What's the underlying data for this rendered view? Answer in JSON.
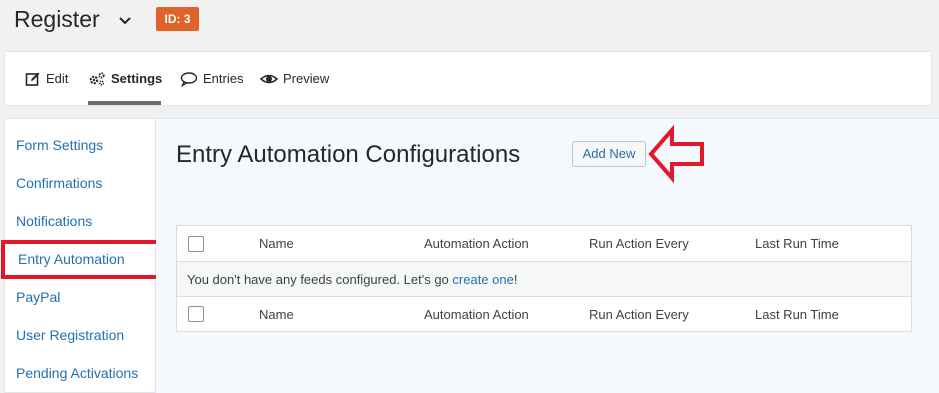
{
  "header": {
    "title": "Register",
    "id_badge": "ID: 3"
  },
  "toolbar": {
    "edit_label": "Edit",
    "settings_label": "Settings",
    "entries_label": "Entries",
    "preview_label": "Preview",
    "active": "Settings"
  },
  "sidebar": {
    "items": [
      {
        "label": "Form Settings"
      },
      {
        "label": "Confirmations"
      },
      {
        "label": "Notifications"
      },
      {
        "label": "Entry Automation"
      },
      {
        "label": "PayPal"
      },
      {
        "label": "User Registration"
      },
      {
        "label": "Pending Activations"
      }
    ],
    "highlighted": "Entry Automation"
  },
  "main": {
    "heading": "Entry Automation Configurations",
    "add_new_label": "Add New"
  },
  "table": {
    "columns": [
      "Name",
      "Automation Action",
      "Run Action Every",
      "Last Run Time"
    ],
    "empty_message_prefix": "You don't have any feeds configured. Let's go ",
    "empty_message_link": "create one",
    "empty_message_suffix": "!"
  },
  "colors": {
    "badge": "#e0632b",
    "link": "#2271b1",
    "highlight": "#e2182a"
  },
  "icons": {
    "edit": "pencil-square-icon",
    "settings": "gears-icon",
    "entries": "speech-bubble-icon",
    "preview": "eye-icon",
    "title_dropdown": "chevron-down-icon",
    "annotation": "left-arrow-icon"
  }
}
